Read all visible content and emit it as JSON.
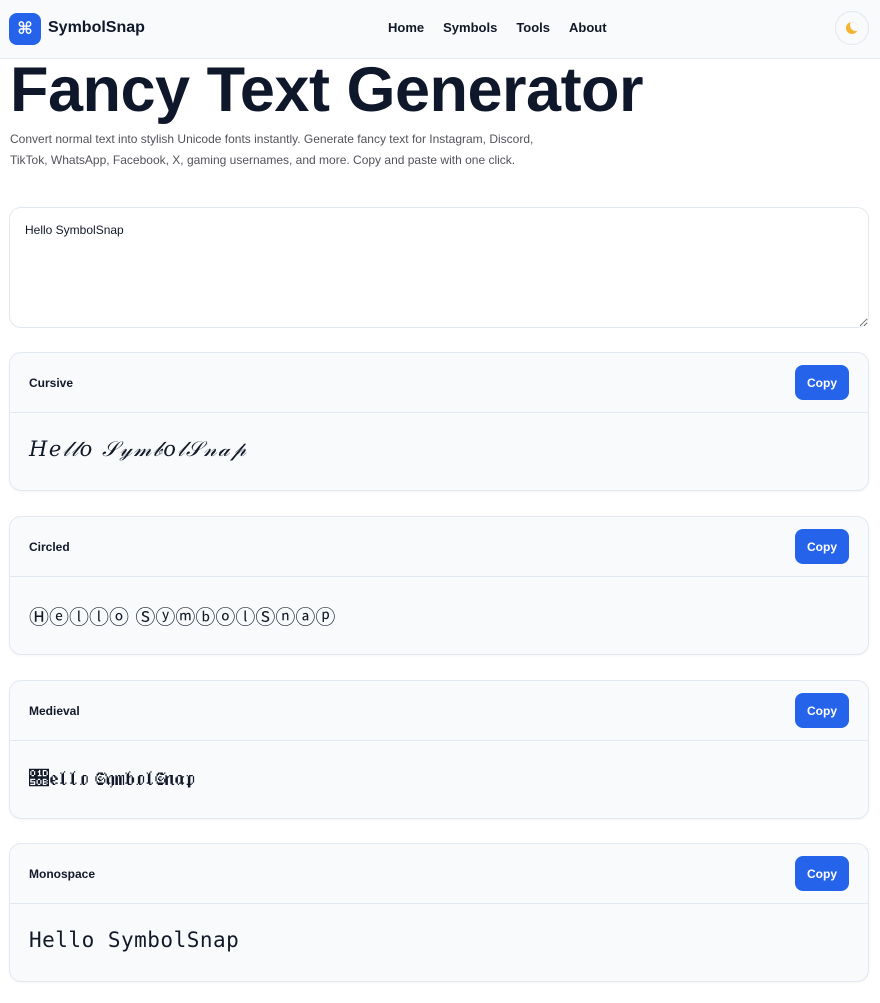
{
  "header": {
    "logo_glyph": "⌘",
    "brand": "SymbolSnap",
    "nav": [
      "Home",
      "Symbols",
      "Tools",
      "About"
    ],
    "theme_icon": "moon-icon"
  },
  "hero": {
    "title": "Fancy Text Generator",
    "subtitle": "Convert normal text into stylish Unicode fonts instantly. Generate fancy text for Instagram, Discord, TikTok, WhatsApp, Facebook, X, gaming usernames, and more. Copy and paste with one click."
  },
  "input": {
    "value": "Hello SymbolSnap"
  },
  "styles": [
    {
      "label": "Cursive",
      "output": "𝐻𝑒𝓁𝓁𝑜 𝒮𝓎𝓂𝒷𝑜𝓁𝒮𝓃𝒶𝓅",
      "copy_label": "Copy"
    },
    {
      "label": "Circled",
      "output": "Ⓗⓔⓛⓛⓞ ⓈⓨⓜⓑⓞⓛⓈⓝⓐⓟ",
      "copy_label": "Copy"
    },
    {
      "label": "Medieval",
      "output": "𝔋𝔢𝔩𝔩𝔬 𝔖𝔶𝔪𝔟𝔬𝔩𝔖𝔫𝔞𝔭",
      "copy_label": "Copy"
    },
    {
      "label": "Monospace",
      "output": "𝙷𝚎𝚕𝚕𝚘 𝚂𝚢𝚖𝚋𝚘𝚕𝚂𝚗𝚊𝚙",
      "copy_label": "Copy"
    }
  ],
  "colors": {
    "accent": "#2563eb",
    "text": "#0f172a",
    "border": "#e2e8f0",
    "card_bg": "#f8fafc"
  }
}
